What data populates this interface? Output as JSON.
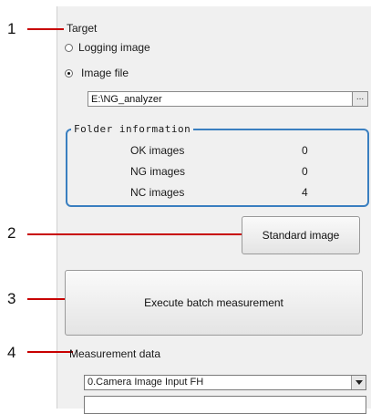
{
  "callouts": [
    "1",
    "2",
    "3",
    "4"
  ],
  "colors": {
    "callout_line": "#c80000",
    "folder_border": "#3a7fc0",
    "panel_bg": "#f0f0f0"
  },
  "target": {
    "label": "Target",
    "options": [
      {
        "label": "Logging image",
        "selected": false
      },
      {
        "label": "Image file",
        "selected": true
      }
    ],
    "path_value": "E:\\NG_analyzer",
    "browse_label": "..."
  },
  "folder_info": {
    "title": "Folder information",
    "rows": [
      {
        "label": "OK images",
        "value": "0"
      },
      {
        "label": "NG images",
        "value": "0"
      },
      {
        "label": "NC images",
        "value": "4"
      }
    ]
  },
  "standard_image_button": "Standard image",
  "execute_button": "Execute batch measurement",
  "measurement": {
    "label": "Measurement data",
    "selected": "0.Camera Image Input FH"
  }
}
